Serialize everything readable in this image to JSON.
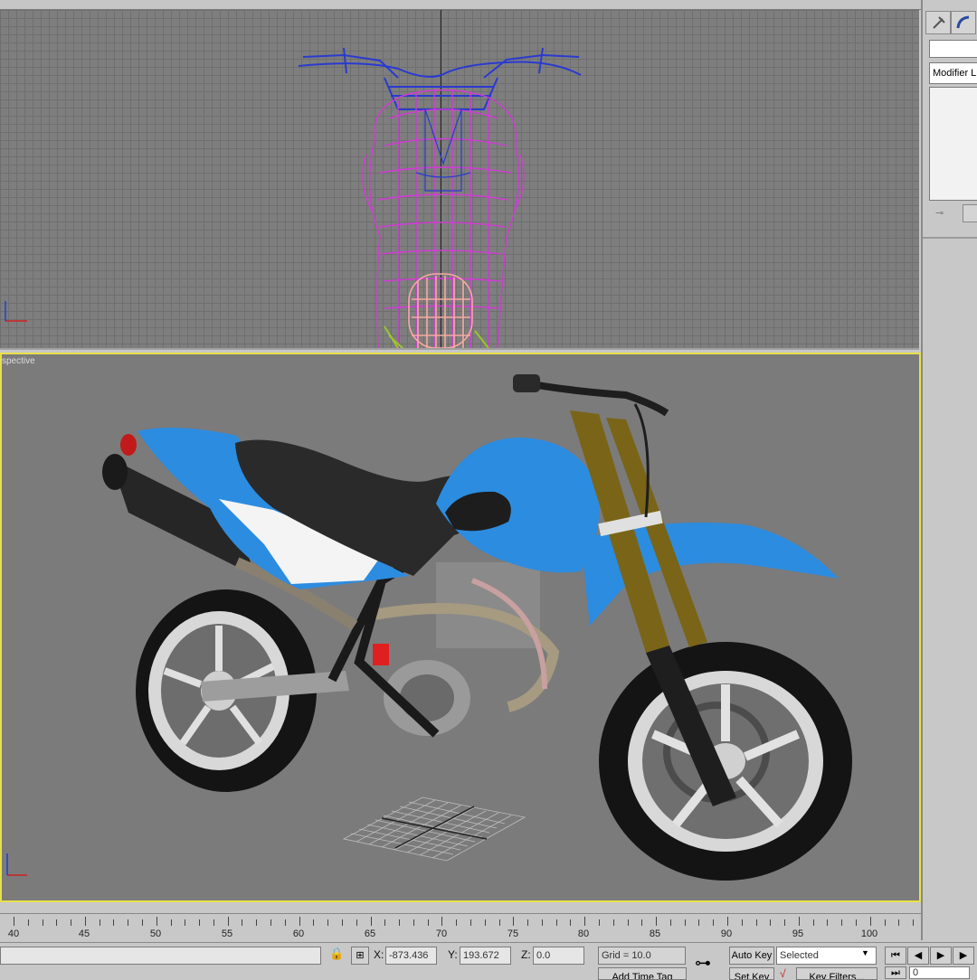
{
  "viewports": {
    "top_label": "",
    "persp_label": "spective"
  },
  "command_panel": {
    "modifier_list": "Modifier Lis"
  },
  "time_ruler": {
    "labels": [
      "40",
      "45",
      "50",
      "55",
      "60",
      "65",
      "70",
      "75",
      "80",
      "85",
      "90",
      "95",
      "100"
    ]
  },
  "status": {
    "x_label": "X:",
    "x_value": "-873.436",
    "y_label": "Y:",
    "y_value": "193.672",
    "z_label": "Z:",
    "z_value": "0.0",
    "grid": "Grid = 10.0",
    "add_time_tag": "Add Time Tag",
    "auto_key": "Auto Key",
    "set_key": "Set Key",
    "selected": "Selected",
    "key_filters": "Key Filters...",
    "frame": "0"
  },
  "colors": {
    "active_viewport_border": "#e8e04a",
    "bike_blue": "#2c8ce0",
    "wire_blue": "#2a3ad0",
    "wire_magenta": "#d23ad6"
  }
}
